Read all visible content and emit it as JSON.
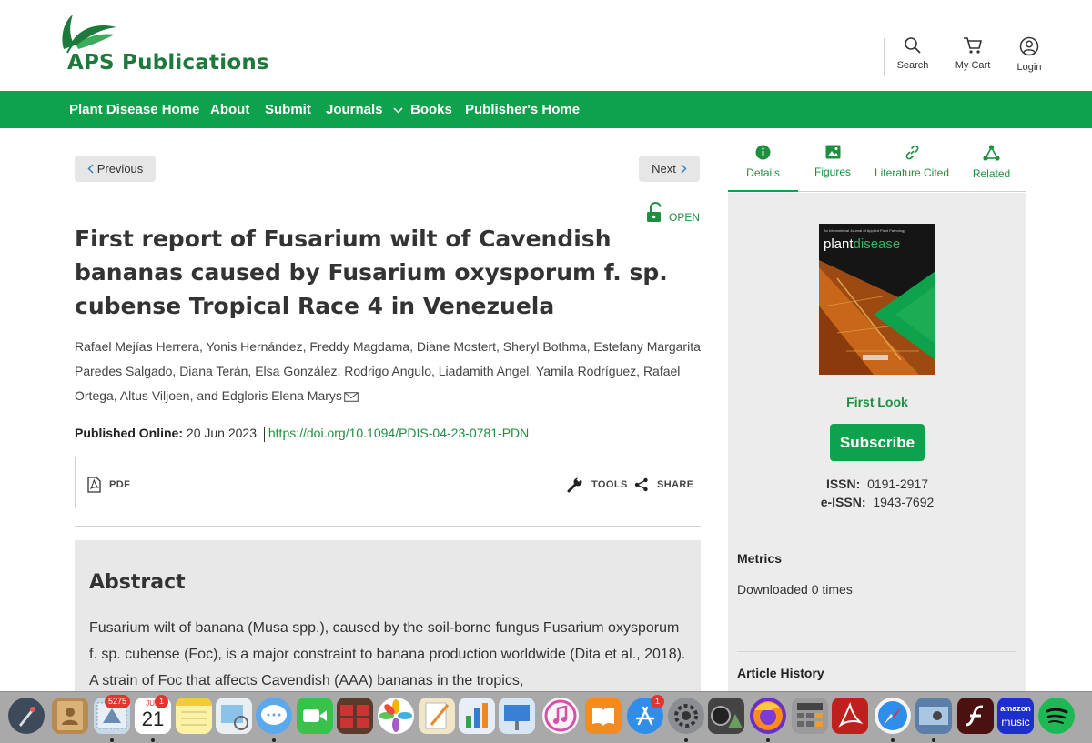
{
  "header": {
    "logo_text": "APS Publications",
    "search_label": "Search",
    "cart_label": "My Cart",
    "login_label": "Login"
  },
  "nav": {
    "items": [
      "Plant Disease Home",
      "About",
      "Submit",
      "Journals",
      "Books",
      "Publisher's Home"
    ]
  },
  "article": {
    "previous_label": "Previous",
    "next_label": "Next",
    "access_label": "OPEN",
    "title": "First report of Fusarium wilt of Cavendish bananas caused by Fusarium oxysporum f. sp. cubense Tropical Race 4 in Venezuela",
    "authors": "Rafael Mejías Herrera, Yonis Hernández, Freddy Magdama, Diane Mostert, Sheryl Bothma, Estefany Margarita Paredes Salgado, Diana Terán, Elsa González, Rodrigo Angulo, Liadamith Angel, Yamila Rodríguez, Rafael Ortega, Altus Viljoen, and Edgloris Elena Marys",
    "published_label": "Published Online:",
    "published_date": "20 Jun 2023",
    "doi": "https://doi.org/10.1094/PDIS-04-23-0781-PDN",
    "pdf_label": "PDF",
    "tools_label": "TOOLS",
    "share_label": "SHARE"
  },
  "abstract": {
    "heading": "Abstract",
    "text": "Fusarium wilt of banana (Musa spp.), caused by the soil-borne fungus Fusarium oxysporum f. sp. cubense (Foc), is a major constraint to banana production worldwide (Dita et al., 2018). A strain of Foc that affects Cavendish (AAA) bananas in the tropics,"
  },
  "sidebar": {
    "tabs": [
      "Details",
      "Figures",
      "Literature Cited",
      "Related"
    ],
    "cover_small_text": "An International Journal of Applied Plant Pathology",
    "cover_title_part1": "plant",
    "cover_title_part2": "disease",
    "first_look": "First Look",
    "subscribe_label": "Subscribe",
    "issn_label": "ISSN:",
    "issn_value": "0191-2917",
    "eissn_label": "e-ISSN:",
    "eissn_value": "1943-7692",
    "metrics_heading": "Metrics",
    "metrics_value": "Downloaded 0 times",
    "history_heading": "Article History"
  },
  "dock": {
    "mail_badge": "5275",
    "calendar_month": "JUN",
    "calendar_day": "21",
    "calendar_badge": "1",
    "appstore_badge": "1",
    "amazon_music_line1": "amazon",
    "amazon_music_line2": "music"
  },
  "colors": {
    "brand_green": "#0ea24c",
    "link_green": "#1d8f3f",
    "logo_green": "#1e7a3c"
  }
}
